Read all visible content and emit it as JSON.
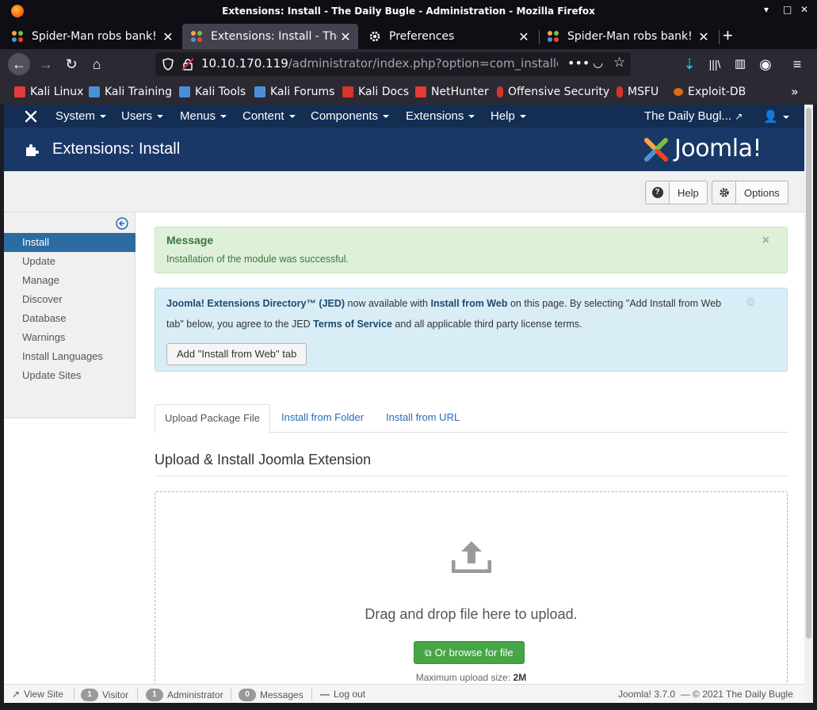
{
  "window": {
    "title": "Extensions: Install - The Daily Bugle - Administration - Mozilla Firefox"
  },
  "tabs": [
    {
      "label": "Spider-Man robs bank!",
      "active": false,
      "favicon": "joomla-icon"
    },
    {
      "label": "Extensions: Install - The I",
      "active": true,
      "favicon": "joomla-icon"
    },
    {
      "label": "Preferences",
      "active": false,
      "favicon": "gear-icon"
    },
    {
      "label": "Spider-Man robs bank!",
      "active": false,
      "favicon": "joomla-icon"
    }
  ],
  "urlbar": {
    "host": "10.10.170.119",
    "path": "/administrator/index.php?option=com_installer&view"
  },
  "bookmarks": [
    {
      "label": "Kali Linux",
      "icon": "kali-icon",
      "color": "#e23b3b"
    },
    {
      "label": "Kali Training",
      "icon": "kali-icon",
      "color": "#4a90d9"
    },
    {
      "label": "Kali Tools",
      "icon": "kali-icon",
      "color": "#4a90d9"
    },
    {
      "label": "Kali Forums",
      "icon": "kali-icon",
      "color": "#4a90d9"
    },
    {
      "label": "Kali Docs",
      "icon": "docs-icon",
      "color": "#d9342b"
    },
    {
      "label": "NetHunter",
      "icon": "kali-icon",
      "color": "#e23b3b"
    },
    {
      "label": "Offensive Security",
      "icon": "offsec-icon",
      "color": "#d9342b"
    },
    {
      "label": "MSFU",
      "icon": "offsec-icon",
      "color": "#d9342b"
    },
    {
      "label": "Exploit-DB",
      "icon": "exploitdb-icon",
      "color": "#e06a1b"
    }
  ],
  "joomla_nav": {
    "menu": [
      "System",
      "Users",
      "Menus",
      "Content",
      "Components",
      "Extensions",
      "Help"
    ],
    "site_name": "The Daily Bugl..."
  },
  "header": {
    "title": "Extensions: Install",
    "logo_text": "Joomla!"
  },
  "toolbar": {
    "help_label": "Help",
    "options_label": "Options"
  },
  "sidebar": {
    "items": [
      {
        "label": "Install",
        "active": true
      },
      {
        "label": "Update",
        "active": false
      },
      {
        "label": "Manage",
        "active": false
      },
      {
        "label": "Discover",
        "active": false
      },
      {
        "label": "Database",
        "active": false
      },
      {
        "label": "Warnings",
        "active": false
      },
      {
        "label": "Install Languages",
        "active": false
      },
      {
        "label": "Update Sites",
        "active": false
      }
    ]
  },
  "message": {
    "heading": "Message",
    "body": "Installation of the module was successful.",
    "close": "×"
  },
  "jed_notice": {
    "jed_name": "Joomla! Extensions Directory™ (JED)",
    "text1": " now available with ",
    "install_from_web": "Install from Web",
    "text2": " on this page.  By selecting \"Add Install from Web",
    "text3": "tab\" below, you agree to the JED ",
    "terms": "Terms of Service",
    "text4": " and all applicable third party license terms.",
    "button": "Add \"Install from Web\" tab"
  },
  "install_tabs": [
    "Upload Package File",
    "Install from Folder",
    "Install from URL"
  ],
  "upload": {
    "section_title": "Upload & Install Joomla Extension",
    "drop_text": "Drag and drop file here to upload.",
    "browse_label": "Or browse for file",
    "max_label": "Maximum upload size: ",
    "max_value": "2M"
  },
  "statusbar": {
    "view_site": "View Site",
    "visitor_count": "1",
    "visitor_label": "Visitor",
    "admin_count": "1",
    "admin_label": "Administrator",
    "messages_count": "0",
    "messages_label": "Messages",
    "logout": "Log out",
    "version": "Joomla! 3.7.0",
    "copyright": "— © 2021 The Daily Bugle"
  },
  "colors": {
    "nav_bg": "#132d53",
    "header_bg": "#1a3867",
    "active_blue": "#2d6ca2",
    "success_bg": "#dff0d8",
    "info_bg": "#d9edf7",
    "browse_green": "#46a546"
  }
}
